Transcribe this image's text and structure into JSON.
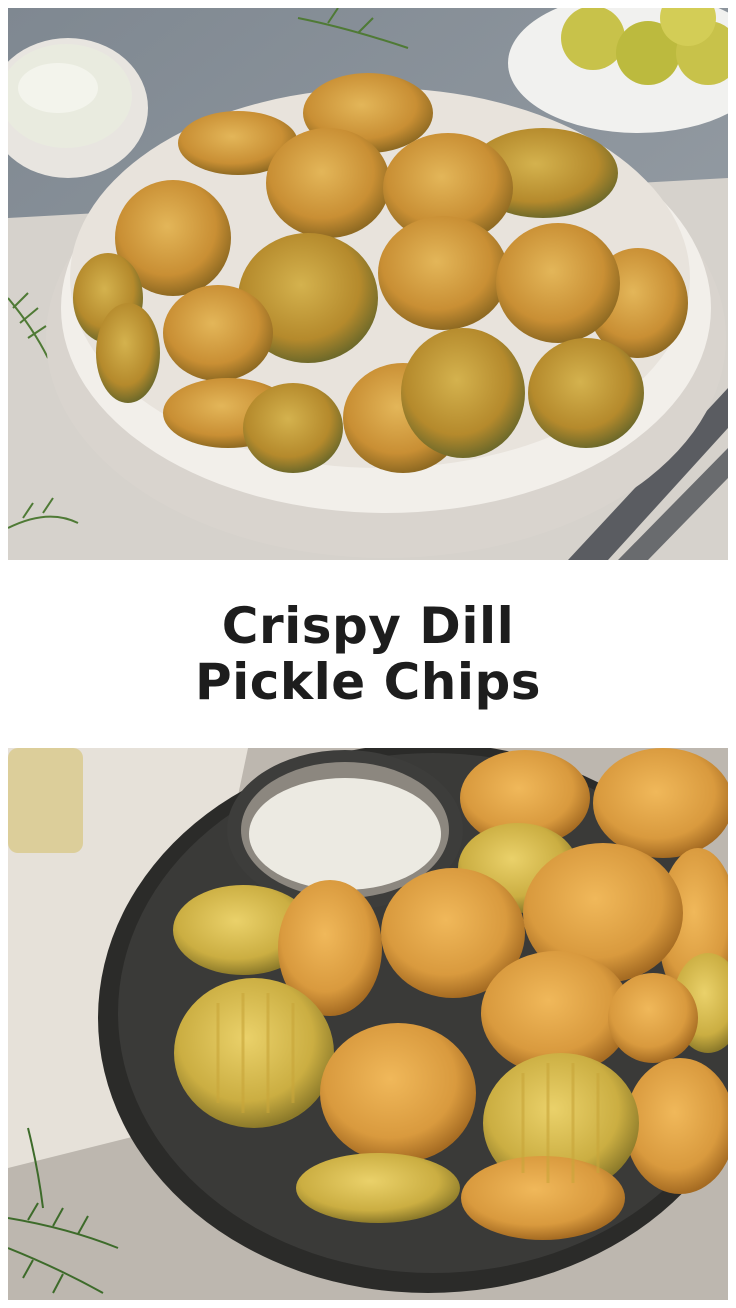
{
  "title": {
    "line1": "Crispy Dill",
    "line2": "Pickle Chips"
  },
  "photos": {
    "top": {
      "subject": "fried pickle chips in white bowl",
      "colors": {
        "background": "#8a929a",
        "bowl": "#efebe6",
        "chip": "#c98f34",
        "linen": "#d8d4cf"
      }
    },
    "bottom": {
      "subject": "fried pickle chips in dark bowl with dip",
      "colors": {
        "background": "#b9b3ab",
        "bowl": "#3a3a38",
        "chip": "#d99a3e",
        "dip": "#eceae2"
      }
    }
  }
}
